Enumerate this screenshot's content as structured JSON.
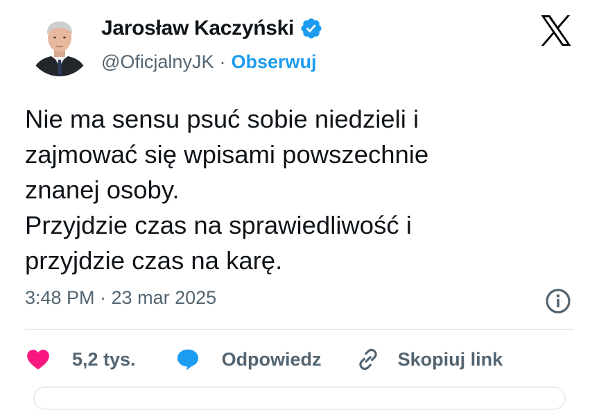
{
  "author": {
    "name": "Jarosław Kaczyński",
    "handle": "@OficjalnyJK",
    "separator": "·",
    "follow_label": "Obserwuj"
  },
  "tweet": {
    "lines": [
      "Nie ma sensu psuć sobie niedzieli i",
      "zajmować się wpisami powszechnie",
      "znanej osoby.",
      "Przyjdzie czas na sprawiedliwość i",
      "przyjdzie czas na karę."
    ],
    "timestamp": "3:48 PM · 23 mar 2025"
  },
  "actions": {
    "like_count": "5,2 tys.",
    "reply_label": "Odpowiedz",
    "copy_link_label": "Skopiuj link"
  },
  "icons": {
    "verified": "verified-badge-icon",
    "logo": "x-logo-icon",
    "info": "info-icon",
    "like": "heart-icon",
    "reply": "speech-bubble-icon",
    "link": "link-icon"
  },
  "colors": {
    "text": "#0f1419",
    "secondary": "#536471",
    "accent": "#1d9bf0",
    "like": "#f91880",
    "divider": "#e6ecf0"
  }
}
